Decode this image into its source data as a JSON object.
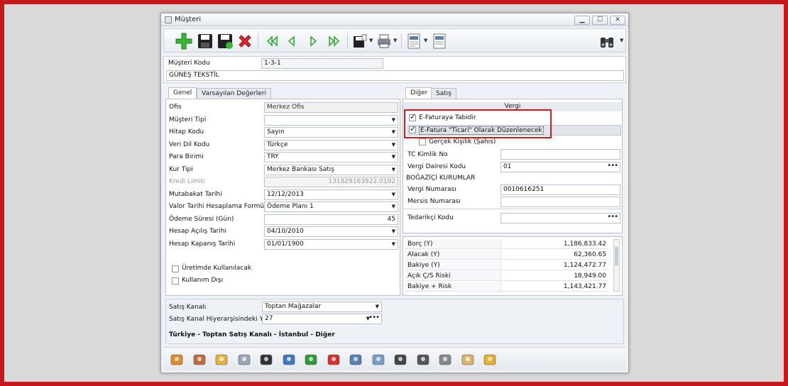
{
  "window": {
    "title": "Müşteri",
    "min": "▁",
    "max": "☐",
    "close": "✕"
  },
  "toolbar": {
    "icons": [
      "add-icon",
      "save-icon",
      "save-new-icon",
      "delete-icon",
      "first-icon",
      "prev-icon",
      "next-icon",
      "last-icon",
      "save-as-icon",
      "print-icon",
      "layout-icon",
      "layout2-icon",
      "search-binoculars-icon"
    ]
  },
  "header": {
    "code_label": "Müşteri Kodu",
    "code_value": "1-3-1",
    "name_value": "GÜNEŞ TEKSTİL"
  },
  "left_tabs": [
    "Genel",
    "Varsayılan Değerleri"
  ],
  "general": {
    "rows": [
      {
        "label": "Ofis",
        "value": "Merkez Ofis",
        "type": "gray"
      },
      {
        "label": "Müşteri Tipi",
        "value": "",
        "type": "combo"
      },
      {
        "label": "Hitap Kodu",
        "value": "Sayın",
        "type": "combo"
      },
      {
        "label": "Veri Dil Kodu",
        "value": "Türkçe",
        "type": "combo"
      },
      {
        "label": "Para Birimi",
        "value": "TRY",
        "type": "combo"
      },
      {
        "label": "Kur Tipi",
        "value": "Merkez Bankası Satış",
        "type": "combo"
      },
      {
        "label": "Kredi Limiti",
        "value": "131829163922.0192",
        "type": "disabled"
      },
      {
        "label": "Mutabakat Tarihi",
        "value": "12/12/2013",
        "type": "combo"
      },
      {
        "label": "Valor Tarihi Hesaplama Formülü",
        "value": "Ödeme Planı 1",
        "type": "combo"
      },
      {
        "label": "Ödeme Süresi (Gün)",
        "value": "45",
        "type": "num"
      },
      {
        "label": "Hesap Açılış Tarihi",
        "value": "04/10/2010",
        "type": "combo"
      },
      {
        "label": "Hesap Kapanış Tarihi",
        "value": "01/01/1900",
        "type": "combo"
      }
    ],
    "check1": "Üretimde Kullanılacak",
    "check2": "Kullanım Dışı"
  },
  "right_tabs": [
    "Diğer",
    "Satış"
  ],
  "vergi": {
    "group_title": "Vergi",
    "efatura": "E-Faturaya Tabidir",
    "efatura_ticari": "E-Fatura \"Ticari\" Olarak Düzenlenecek",
    "gercek": "Gerçek Kişilik (Şahıs)",
    "tc_label": "TC Kimlik No",
    "tc_value": "",
    "daire_label": "Vergi Dairesi Kodu",
    "daire_value": "01",
    "daire_name": "BOĞAZİÇİ KURUMLAR",
    "no_label": "Vergi Numarası",
    "no_value": "0010616251",
    "mersis_label": "Mersis Numarası",
    "mersis_value": "",
    "tedarikci_label": "Tedarikçi Kodu",
    "tedarikci_value": ""
  },
  "balances": [
    {
      "label": "Borç (Y)",
      "value": "1,186,833.42"
    },
    {
      "label": "Alacak (Y)",
      "value": "62,360.65"
    },
    {
      "label": "Bakiye (Y)",
      "value": "1,124,472.77"
    },
    {
      "label": "Açık Ç/S Riski",
      "value": "18,949.00"
    },
    {
      "label": "Bakiye + Risk",
      "value": "1,143,421.77"
    }
  ],
  "sales": {
    "kanal_label": "Satış Kanalı",
    "kanal_value": "Toptan Mağazalar",
    "hier_label": "Satış Kanal Hiyerarşisindeki Yeri",
    "hier_value": "27",
    "path": "Türkiye - Toptan Satış Kanalı - İstanbul - Diğer"
  },
  "bottom_icons": [
    "contacts-icon",
    "documents-icon",
    "pencil-icon",
    "mail-icon",
    "headset-icon",
    "user-icon",
    "warning-icon",
    "phone-icon",
    "users-icon",
    "card-icon",
    "person-icon",
    "camera-icon",
    "bank-icon",
    "book-icon",
    "folder-icon"
  ]
}
